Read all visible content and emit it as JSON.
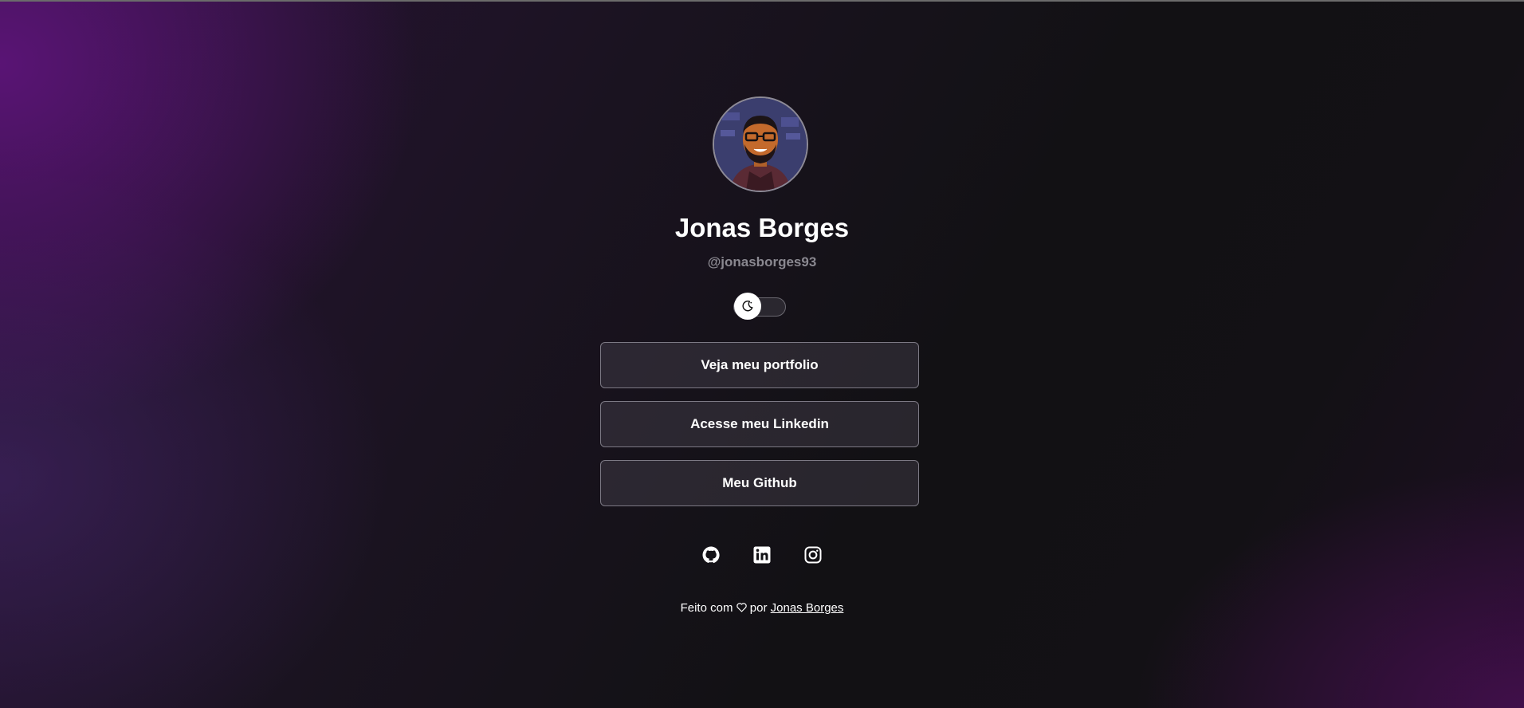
{
  "profile": {
    "name": "Jonas Borges",
    "handle": "@jonasborges93"
  },
  "theme_toggle": {
    "icon": "moon-icon",
    "state": "dark"
  },
  "links": [
    {
      "label": "Veja meu portfolio"
    },
    {
      "label": "Acesse meu Linkedin"
    },
    {
      "label": "Meu Github"
    }
  ],
  "socials": [
    {
      "icon": "github-icon"
    },
    {
      "icon": "linkedin-icon"
    },
    {
      "icon": "instagram-icon"
    }
  ],
  "footer": {
    "prefix": "Feito com",
    "icon": "heart-icon",
    "middle": "por",
    "author_link": "Jonas Borges"
  },
  "colors": {
    "background_dark": "#121114",
    "accent_purple": "#5c1478",
    "button_border": "#7c7984",
    "handle_text": "#8a8890"
  }
}
